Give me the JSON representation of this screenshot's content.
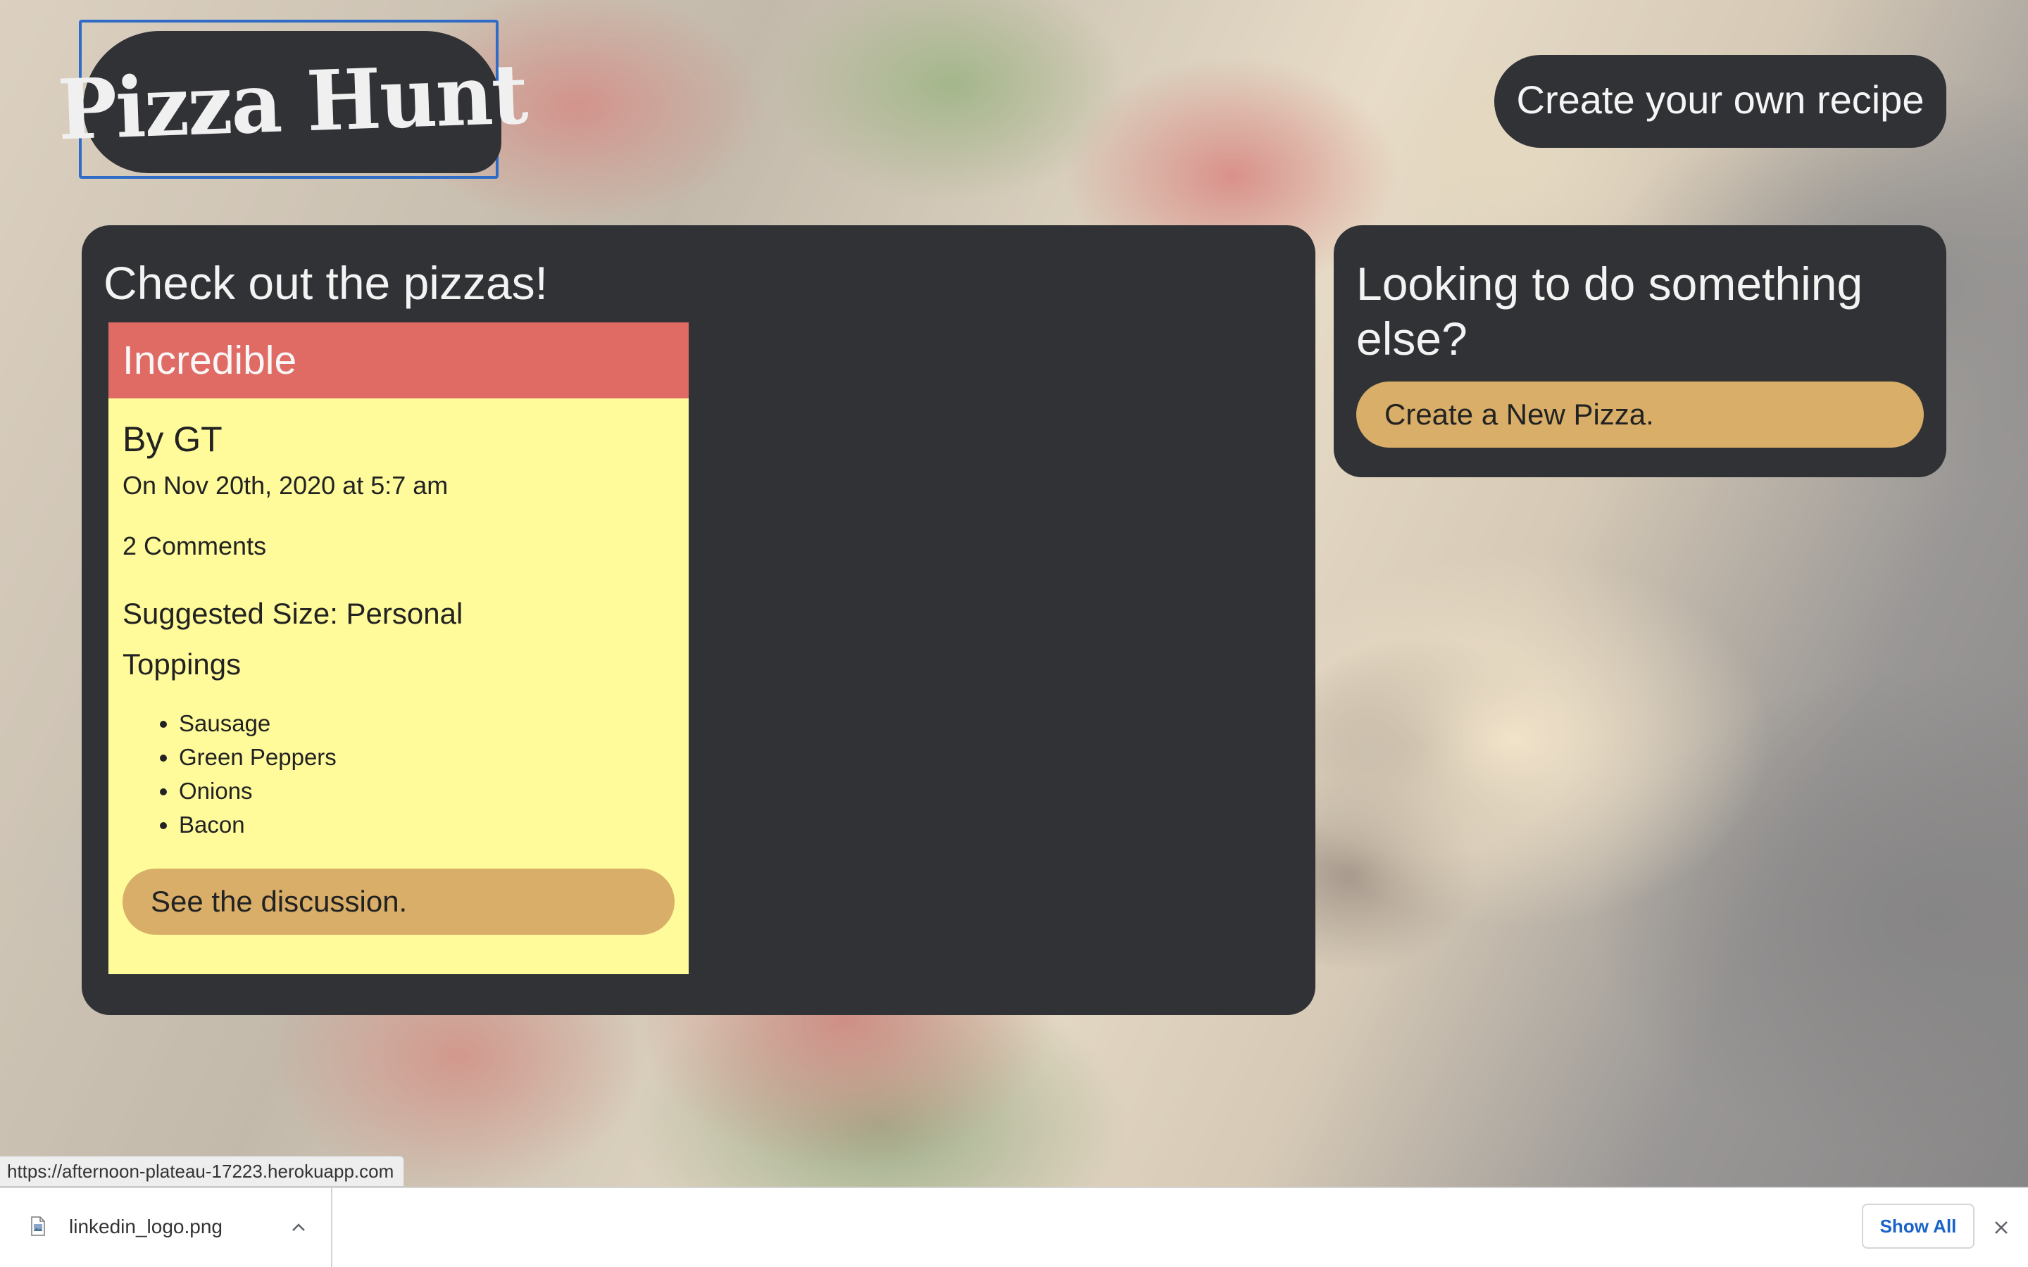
{
  "header": {
    "logo_text": "Pizza Hunt",
    "create_recipe_label": "Create your own recipe"
  },
  "main": {
    "title": "Check out the pizzas!",
    "pizzas": [
      {
        "name": "Incredible",
        "author": "By GT",
        "date": "On Nov 20th, 2020 at 5:7 am",
        "comments": "2 Comments",
        "size": "Suggested Size: Personal",
        "toppings_title": "Toppings",
        "toppings": [
          "Sausage",
          "Green Peppers",
          "Onions",
          "Bacon"
        ],
        "discussion_label": "See the discussion."
      }
    ]
  },
  "side": {
    "title": "Looking to do something else?",
    "new_pizza_label": "Create a New Pizza."
  },
  "status_bar": {
    "url": "https://afternoon-plateau-17223.herokuapp.com"
  },
  "download_shelf": {
    "file_name": "linkedin_logo.png",
    "file_icon": "file-image-icon",
    "show_all_label": "Show All"
  },
  "colors": {
    "panel_bg": "#303236",
    "card_header": "#e06a64",
    "card_body": "#fffb9a",
    "button_gold": "#d9ae68",
    "focus_outline": "#2f6cc8",
    "link_blue": "#1a63c8"
  }
}
